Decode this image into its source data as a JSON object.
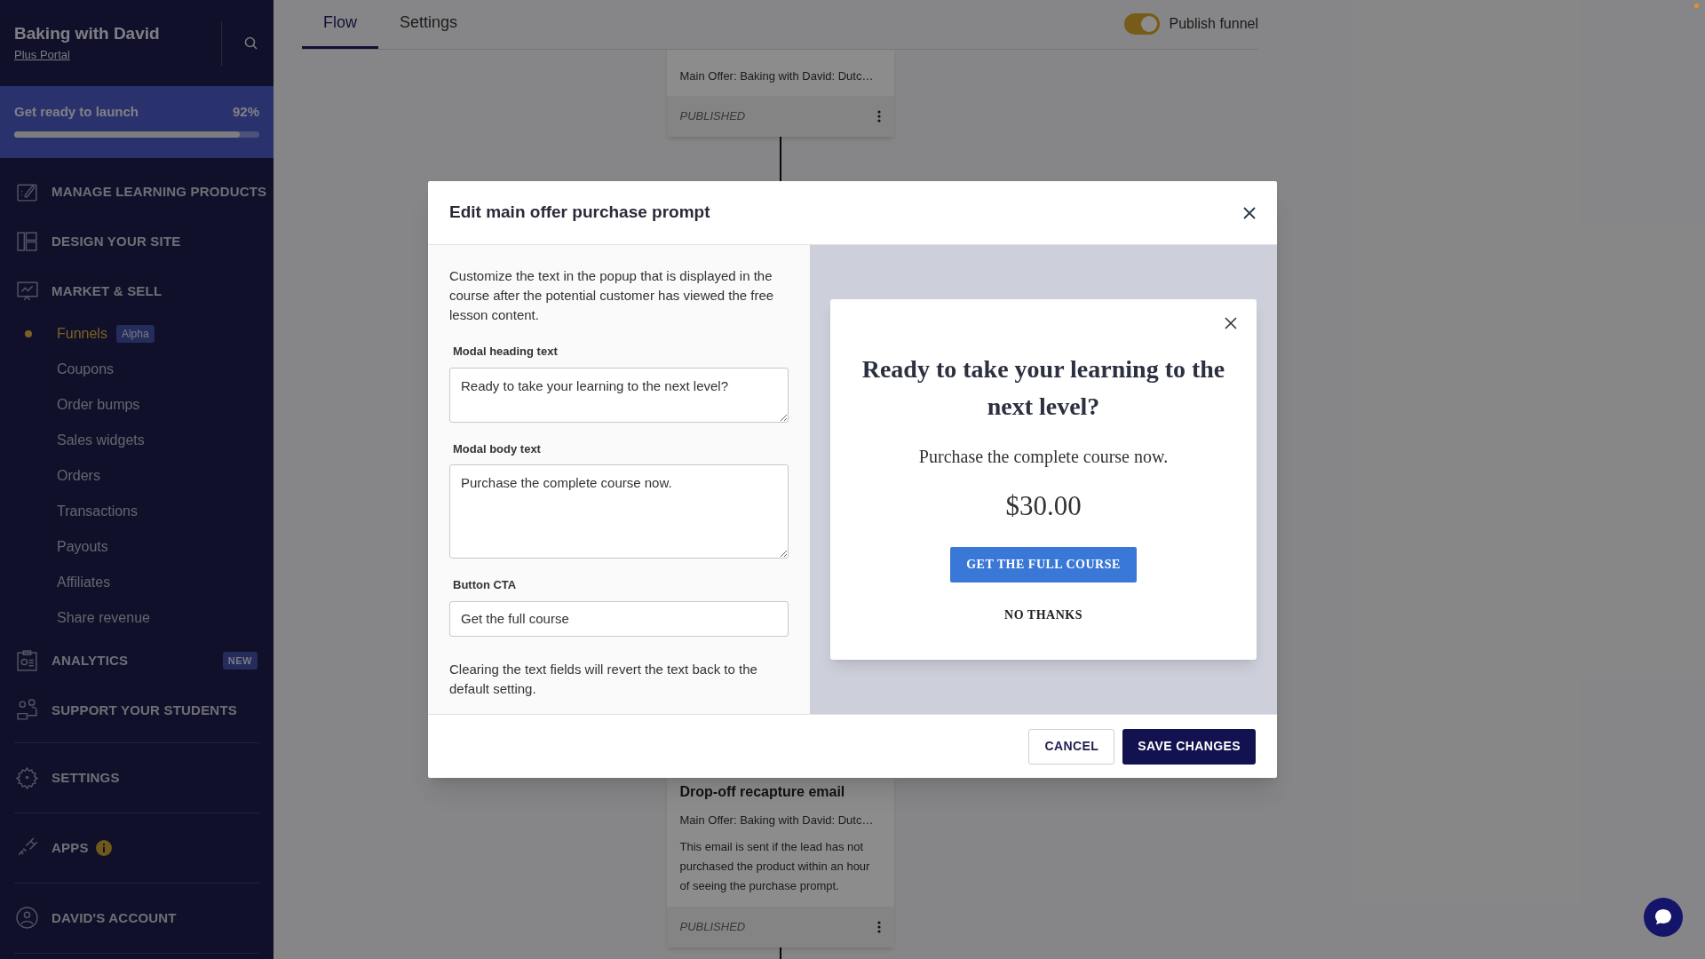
{
  "sidebar": {
    "brand": "Baking with David",
    "portal_link": "Plus Portal",
    "launch": {
      "label": "Get ready to launch",
      "reading": "92%",
      "level": 0.92
    },
    "groups": [
      {
        "items": [
          {
            "kind": "section",
            "label": "MANAGE LEARNING PRODUCTS"
          },
          {
            "kind": "section",
            "label": "DESIGN YOUR SITE"
          },
          {
            "kind": "section",
            "label": "MARKET & SELL"
          },
          {
            "kind": "sub",
            "label": "Funnels",
            "selected": true,
            "badge": "Alpha"
          },
          {
            "kind": "sub",
            "label": "Coupons",
            "selected": false
          },
          {
            "kind": "sub",
            "label": "Order bumps",
            "selected": false
          },
          {
            "kind": "sub",
            "label": "Sales widgets",
            "selected": false
          },
          {
            "kind": "sub",
            "label": "Orders",
            "selected": false
          },
          {
            "kind": "sub",
            "label": "Transactions",
            "selected": false
          },
          {
            "kind": "sub",
            "label": "Payouts",
            "selected": false
          },
          {
            "kind": "sub",
            "label": "Affiliates",
            "selected": false
          },
          {
            "kind": "sub",
            "label": "Share revenue",
            "selected": false
          },
          {
            "kind": "section",
            "label": "ANALYTICS",
            "badge": "NEW"
          },
          {
            "kind": "section",
            "label": "SUPPORT YOUR STUDENTS"
          }
        ]
      },
      {
        "items": [
          {
            "kind": "section",
            "label": "SETTINGS"
          }
        ]
      },
      {
        "items": [
          {
            "kind": "section",
            "label": "APPS",
            "alert": true
          }
        ]
      },
      {
        "items": [
          {
            "kind": "section",
            "label": "DAVID'S ACCOUNT"
          }
        ]
      }
    ]
  },
  "main": {
    "tabs": [
      {
        "label": "Flow",
        "selected": true
      },
      {
        "label": "Settings",
        "selected": false
      }
    ],
    "publish_toggle": {
      "label": "Publish funnel",
      "on": true
    },
    "cards": [
      {
        "subtitle": "Main Offer: Baking with David: Dutc…",
        "status": "PUBLISHED"
      },
      {
        "title": "Drop-off recapture email",
        "subtitle": "Main Offer: Baking with David: Dutc…",
        "description": "This email is sent if the lead has not purchased the product within an hour of seeing the purchase prompt.",
        "status": "PUBLISHED"
      }
    ]
  },
  "modal": {
    "title": "Edit main offer purchase prompt",
    "intro": "Customize the text in the popup that is displayed in the course after the potential customer has viewed the free lesson content.",
    "fields": [
      {
        "kind": "textarea",
        "label": "Modal heading text",
        "value": "Ready to take your learning to the next level?"
      },
      {
        "kind": "textarea",
        "label": "Modal body text",
        "value": "Purchase the complete course now."
      },
      {
        "kind": "input",
        "label": "Button CTA",
        "value": "Get the full course"
      }
    ],
    "note": "Clearing the text fields will revert the text back to the default setting.",
    "preview": {
      "heading": "Ready to take your learning to the next level?",
      "body": "Purchase the complete course now.",
      "price": "$30.00",
      "cta": "GET THE FULL COURSE",
      "decline": "NO THANKS"
    },
    "buttons": [
      {
        "kind": "secondary",
        "label": "CANCEL"
      },
      {
        "kind": "primary",
        "label": "SAVE CHANGES"
      }
    ]
  }
}
